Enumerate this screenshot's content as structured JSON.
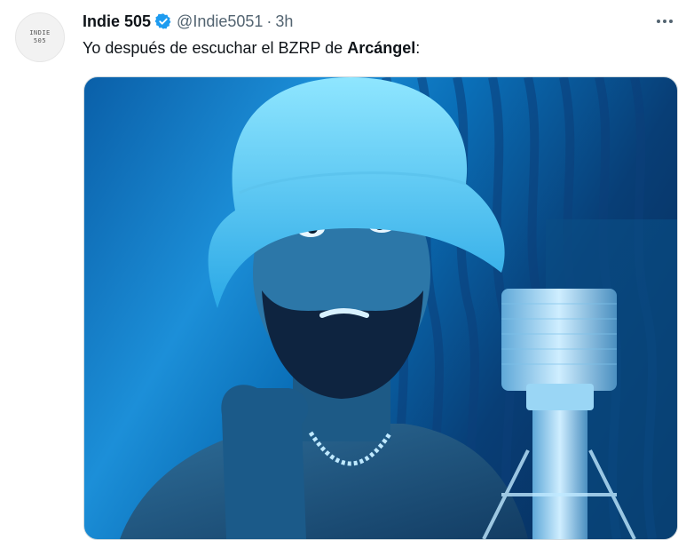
{
  "tweet": {
    "avatar_text_line1": "INDIE",
    "avatar_text_line2": "505",
    "author_name": "Indie 505",
    "handle": "@Indie5051",
    "separator": "·",
    "time": "3h",
    "text_prefix": "Yo después de escuchar el BZRP de ",
    "text_bold": "Arcángel",
    "text_suffix": ":",
    "verified_icon": "verified-badge-icon",
    "more_icon": "more-options-icon"
  },
  "colors": {
    "verified": "#1d9bf0",
    "secondary_text": "#536471",
    "primary_text": "#0f1419"
  }
}
